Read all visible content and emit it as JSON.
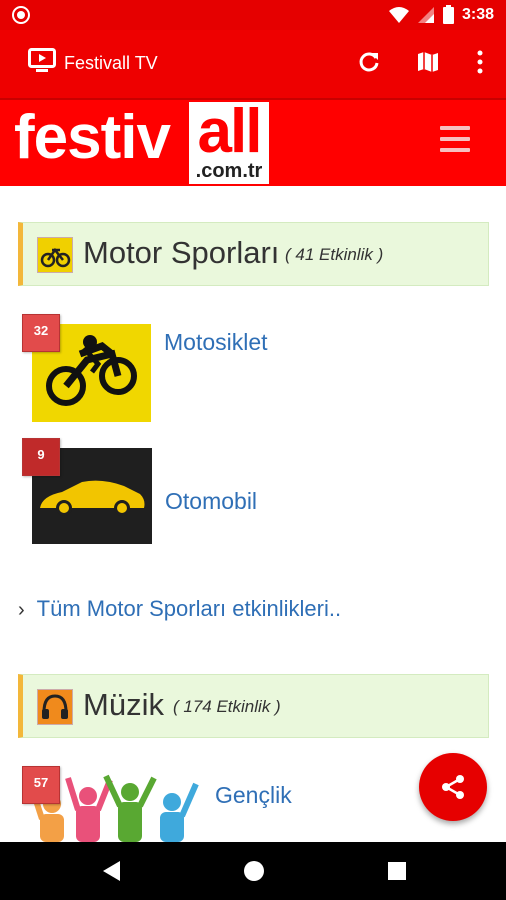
{
  "status_bar": {
    "time": "3:38"
  },
  "app_bar": {
    "title": "Festivall TV"
  },
  "logo": {
    "part1": "festiv",
    "part2": "all",
    "domain": ".com.tr"
  },
  "categories": [
    {
      "title": "Motor Sporları",
      "count": "( 41 Etkinlik )",
      "items": [
        {
          "label": "Motosiklet",
          "badge": "32"
        },
        {
          "label": "Otomobil",
          "badge": "9"
        }
      ],
      "all_link": "Tüm Motor Sporları etkinlikleri.."
    },
    {
      "title": "Müzik",
      "count": "( 174 Etkinlik )",
      "items": [
        {
          "label": "Gençlik",
          "badge": "57"
        }
      ]
    }
  ],
  "colors": {
    "primary": "#ee0000",
    "link": "#2f6fb6",
    "category_bg": "#eaf8dc",
    "accent": "#f3b73a"
  }
}
